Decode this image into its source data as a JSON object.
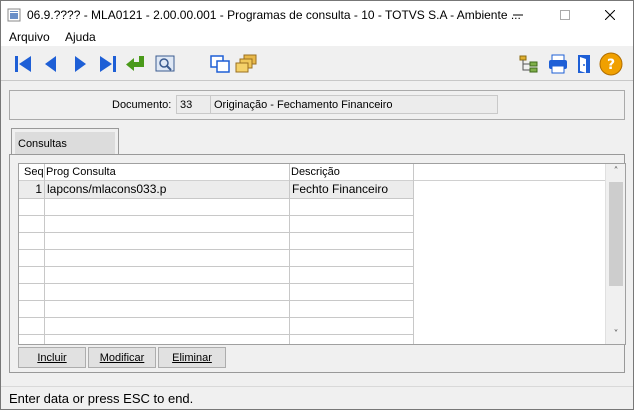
{
  "window": {
    "title": "06.9.???? - MLA0121 - 2.00.00.001 - Programas de consulta - 10 - TOTVS S.A - Ambiente ..."
  },
  "menu": {
    "items": [
      {
        "label": "Arquivo"
      },
      {
        "label": "Ajuda"
      }
    ]
  },
  "toolbar": {
    "icons": [
      "first-icon",
      "previous-icon",
      "next-icon",
      "last-icon",
      "goto-icon",
      "search-icon",
      "copy-icon",
      "folders-icon",
      "tree-icon",
      "print-icon",
      "exit-icon",
      "help-icon"
    ]
  },
  "header": {
    "document_label": "Documento:",
    "document_code": "33",
    "document_description": "Originação - Fechamento Financeiro"
  },
  "tab": {
    "label": "Consultas"
  },
  "grid": {
    "columns": [
      "Seq",
      "Prog Consulta",
      "Descrição"
    ],
    "rows": [
      {
        "seq": "1",
        "prog": "lapcons/mlacons033.p",
        "desc": "Fechto Financeiro"
      }
    ]
  },
  "buttons": {
    "include": "Incluir",
    "modify": "Modificar",
    "delete": "Eliminar"
  },
  "status": {
    "text": "Enter data or press ESC to end."
  },
  "colors": {
    "toolbar_blue": "#1e5fd6",
    "arrow_green": "#4a9a1a",
    "help_orange": "#f0a000"
  }
}
